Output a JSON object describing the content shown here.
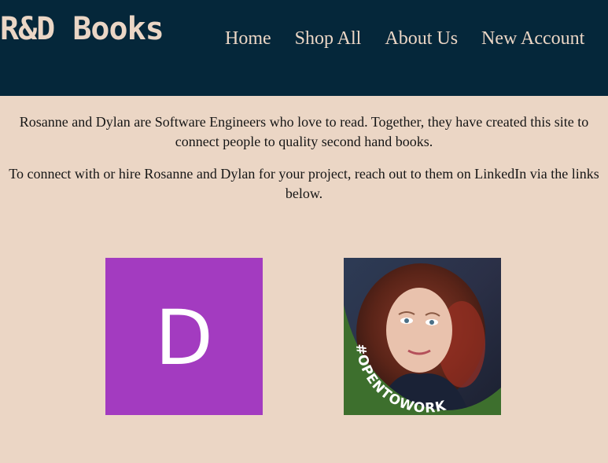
{
  "header": {
    "logo": "R&D Books",
    "nav": {
      "home": "Home",
      "shop_all": "Shop All",
      "about_us": "About Us",
      "new_account": "New Account"
    }
  },
  "about": {
    "paragraph1": "Rosanne and Dylan are Software Engineers who love to read. Together, they have created this site to connect people to quality second hand books.",
    "paragraph2": "To connect with or hire Rosanne and Dylan for your project, reach out to them on LinkedIn via the links below."
  },
  "profiles": {
    "dylan": {
      "initial": "D",
      "color": "#a33bc0"
    },
    "rosanne": {
      "badge": "#OPENTOWORK",
      "badge_color": "#3d6f2d"
    }
  }
}
